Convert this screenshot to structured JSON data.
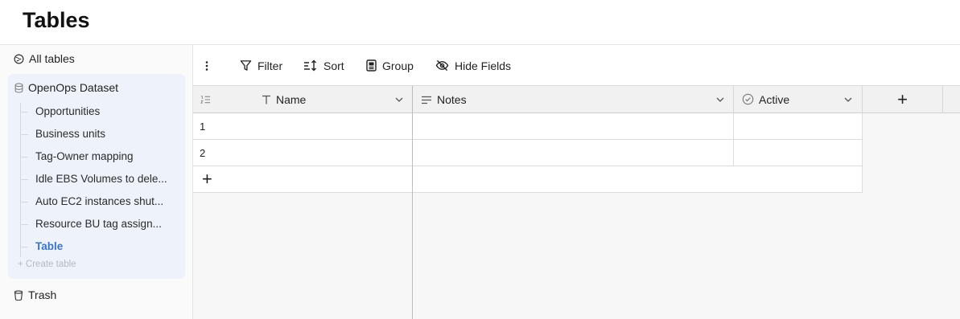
{
  "header": {
    "title": "Tables"
  },
  "sidebar": {
    "all_tables": "All tables",
    "dataset": "OpenOps Dataset",
    "items": [
      "Opportunities",
      "Business units",
      "Tag-Owner mapping",
      "Idle EBS Volumes to dele...",
      "Auto EC2 instances shut...",
      "Resource BU tag assign...",
      "Table"
    ],
    "create_table": "+ Create table",
    "trash": "Trash"
  },
  "toolbar": {
    "filter": "Filter",
    "sort": "Sort",
    "group": "Group",
    "hide_fields": "Hide Fields"
  },
  "table": {
    "columns": [
      "Name",
      "Notes",
      "Active"
    ],
    "rows": [
      {
        "id": "1",
        "name": "",
        "notes": "",
        "active": ""
      },
      {
        "id": "2",
        "name": "",
        "notes": "",
        "active": ""
      }
    ],
    "add_row_symbol": "+",
    "add_column_symbol": "+"
  },
  "colors": {
    "accent": "#3b73c6",
    "group_bg": "#eef3fb"
  }
}
